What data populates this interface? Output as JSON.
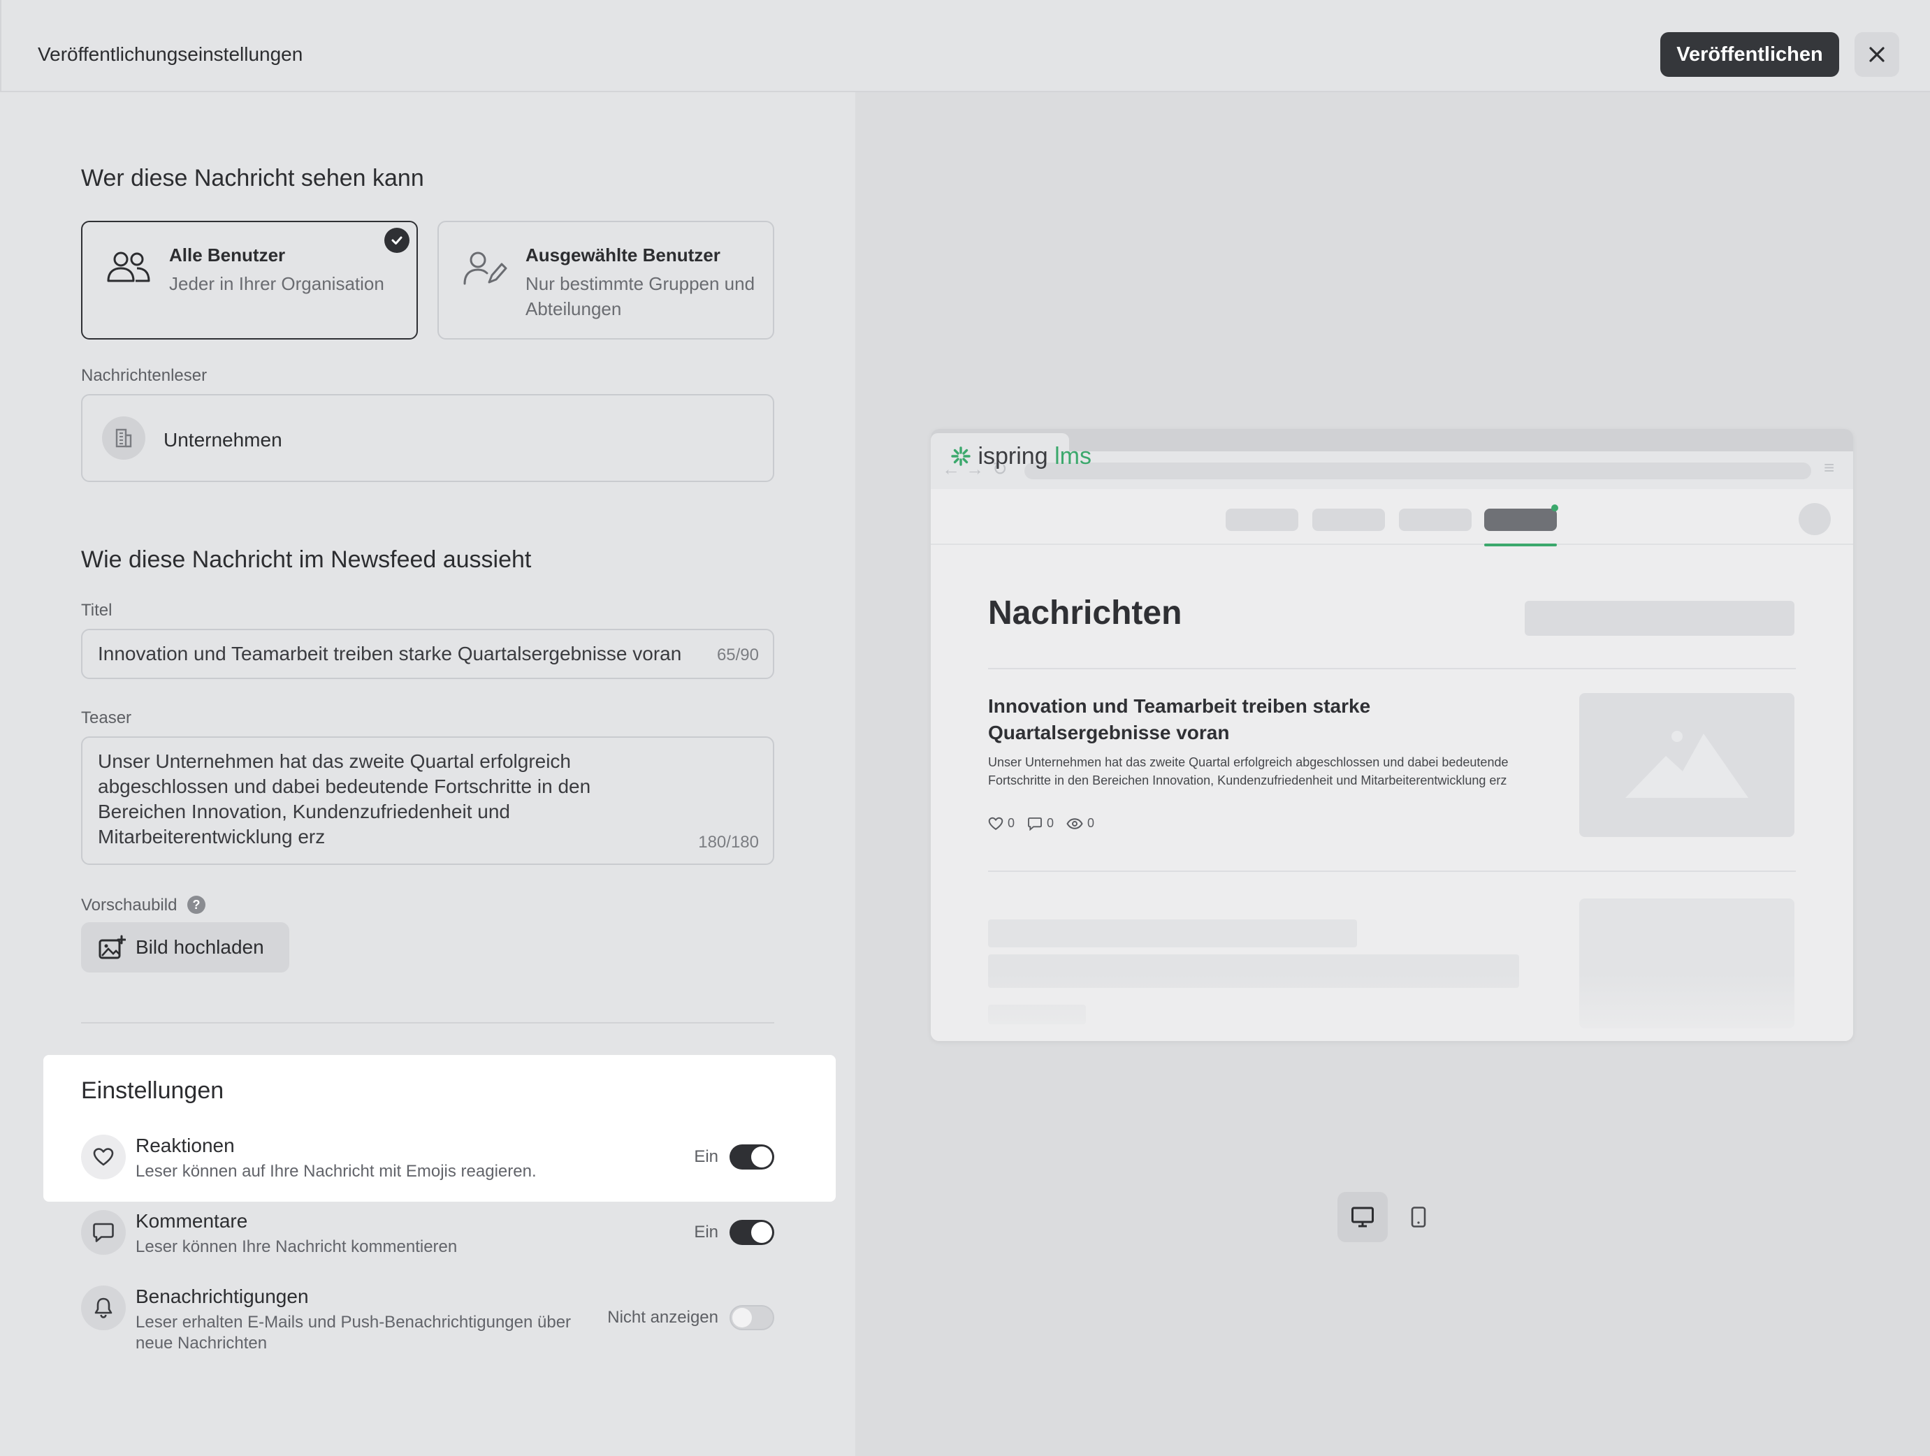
{
  "header": {
    "title": "Veröffentlichungseinstellungen",
    "publish_label": "Veröffentlichen"
  },
  "audience": {
    "section_title": "Wer diese Nachricht sehen kann",
    "options": [
      {
        "title": "Alle Benutzer",
        "subtitle": "Jeder in Ihrer Organisation",
        "selected": true
      },
      {
        "title": "Ausgewählte Benutzer",
        "subtitle": "Nur bestimmte Gruppen und Abteilungen",
        "selected": false
      }
    ],
    "readers_label": "Nachrichtenleser",
    "reader_value": "Unternehmen"
  },
  "appearance": {
    "section_title": "Wie diese Nachricht im Newsfeed aussieht",
    "title_label": "Titel",
    "title_value": "Innovation und Teamarbeit treiben starke Quartalsergebnisse voran",
    "title_counter": "65/90",
    "teaser_label": "Teaser",
    "teaser_value": "Unser Unternehmen hat das zweite Quartal erfolgreich abgeschlossen und dabei bedeutende Fortschritte in den Bereichen Innovation, Kundenzufriedenheit und Mitarbeiterentwicklung erz",
    "teaser_counter": "180/180",
    "thumbnail_label": "Vorschaubild",
    "upload_label": "Bild hochladen"
  },
  "settings": {
    "section_title": "Einstellungen",
    "items": [
      {
        "title": "Reaktionen",
        "description": "Leser können auf Ihre Nachricht mit Emojis reagieren.",
        "state": "Ein",
        "on": true
      },
      {
        "title": "Kommentare",
        "description": "Leser können Ihre Nachricht kommentieren",
        "state": "Ein",
        "on": true
      },
      {
        "title": "Benachrichtigungen",
        "description": "Leser erhalten E-Mails und Push-Benachrichtigungen über neue Nachrichten",
        "state": "Nicht anzeigen",
        "on": false
      }
    ]
  },
  "preview": {
    "logo_brand": "ispring",
    "logo_product": "lms",
    "heading": "Nachrichten",
    "post_title": "Innovation und Teamarbeit treiben starke Quartalsergebnisse voran",
    "post_teaser": "Unser Unternehmen hat das zweite Quartal erfolgreich abgeschlossen und dabei bedeutende Fortschritte in den Bereichen Innovation, Kundenzufriedenheit und Mitarbeiterentwicklung erz",
    "likes": "0",
    "comments": "0",
    "views": "0"
  },
  "colors": {
    "accent_dark": "#2f3034",
    "brand_green": "#3ba86c"
  }
}
